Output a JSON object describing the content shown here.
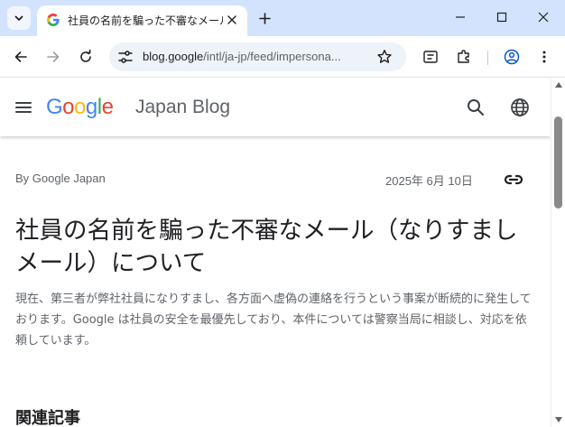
{
  "browser": {
    "tab_title": "社員の名前を騙った不審なメール（",
    "url_domain": "blog.google",
    "url_path": "/intl/ja-jp/feed/impersona...",
    "icons": [
      "tab-search-icon",
      "google-favicon",
      "close-icon",
      "plus-icon",
      "minimize-icon",
      "maximize-icon",
      "window-close-icon",
      "back-arrow-icon",
      "forward-arrow-icon",
      "reload-icon",
      "site-info-icon",
      "star-icon",
      "cast-icon",
      "extensions-icon",
      "profile-icon",
      "more-vert-icon"
    ],
    "colors": {
      "tabstrip": "#d3e3fd",
      "omnibox": "#eef2f9",
      "profile": "#0b57d0"
    }
  },
  "site": {
    "logo": {
      "g1": "G",
      "o1": "o",
      "o2": "o",
      "g2": "g",
      "l": "l",
      "e": "e"
    },
    "logo_colors": {
      "blue": "#4285f4",
      "red": "#ea4335",
      "yellow": "#fbbc05",
      "green": "#34a853"
    },
    "blog_name": "Japan Blog",
    "icons": [
      "menu-icon",
      "search-icon",
      "globe-icon"
    ]
  },
  "article": {
    "byline": "By Google Japan",
    "date": "2025年 6月 10日",
    "title": "社員の名前を騙った不審なメール（なりすましメール）について",
    "summary": "現在、第三者が弊社社員になりすまし、各方面へ虚偽の連絡を行うという事案が断続的に発生しております。Google は社員の安全を最優先しており、本件については警察当局に相談し、対応を依頼しています。",
    "related_heading": "関連記事",
    "icons": [
      "link-icon"
    ]
  }
}
